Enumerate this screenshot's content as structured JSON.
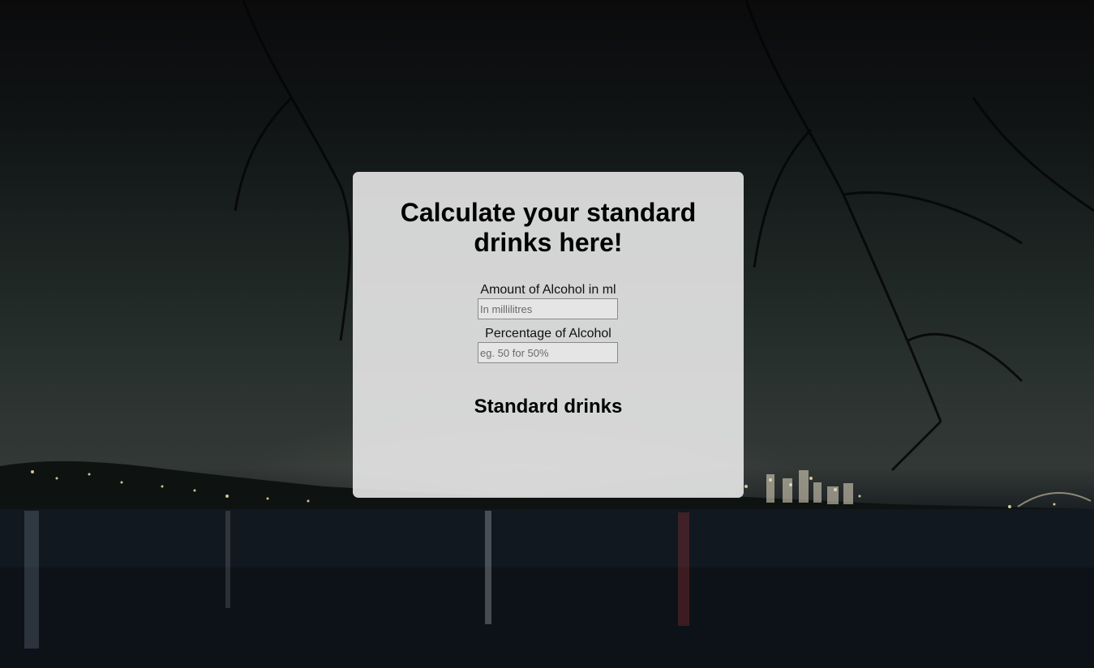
{
  "calculator": {
    "title": "Calculate your standard drinks here!",
    "amount": {
      "label": "Amount of Alcohol in ml",
      "value": "",
      "placeholder": "In millilitres"
    },
    "percentage": {
      "label": "Percentage of Alcohol",
      "value": "",
      "placeholder": "eg. 50 for 50%"
    },
    "result_label": "Standard drinks"
  }
}
